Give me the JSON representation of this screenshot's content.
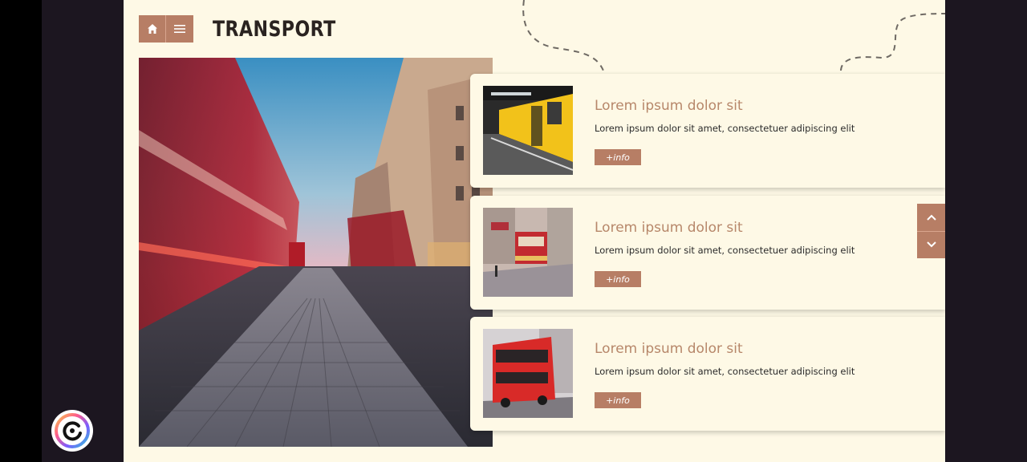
{
  "header": {
    "title": "TRANSPORT"
  },
  "nav": {
    "home_icon": "home-icon",
    "menu_icon": "menu-icon"
  },
  "cards": [
    {
      "title": "Lorem ipsum dolor sit",
      "text": "Lorem ipsum dolor sit amet, consectetuer adipiscing elit",
      "button": "+info",
      "image": "yellow-train-image"
    },
    {
      "title": "Lorem ipsum dolor sit",
      "text": "Lorem ipsum dolor sit amet, consectetuer adipiscing elit",
      "button": "+info",
      "image": "tram-image"
    },
    {
      "title": "Lorem ipsum dolor sit",
      "text": "Lorem ipsum dolor sit amet, consectetuer adipiscing elit",
      "button": "+info",
      "image": "red-bus-image"
    }
  ],
  "colors": {
    "background": "#fef9e6",
    "accent": "#b77e65",
    "title_text": "#2a2320",
    "card_title": "#b7876a"
  }
}
